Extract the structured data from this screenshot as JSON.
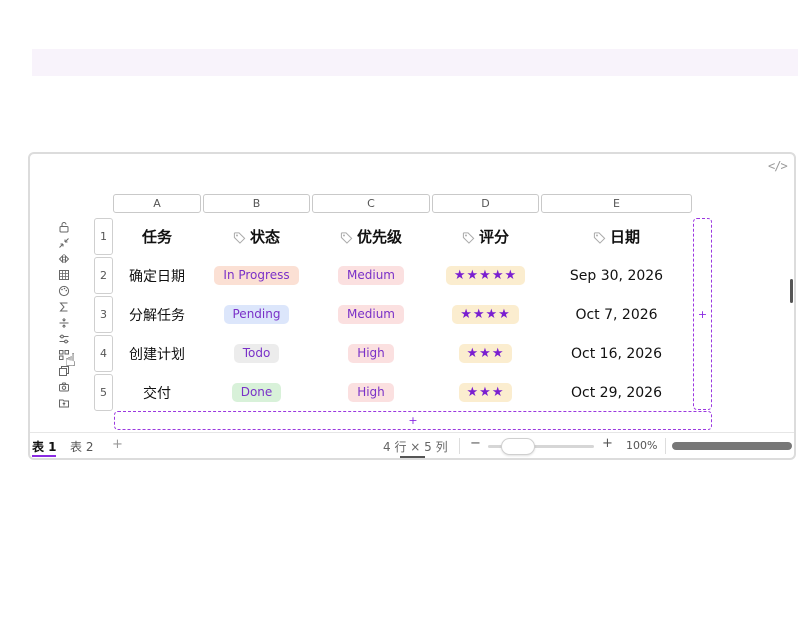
{
  "code_button": "</>",
  "columns": [
    "A",
    "B",
    "C",
    "D",
    "E"
  ],
  "row_numbers": [
    "1",
    "2",
    "3",
    "4",
    "5"
  ],
  "header_row": {
    "task": "任务",
    "status": "状态",
    "priority": "优先级",
    "rating": "评分",
    "date": "日期"
  },
  "rows": [
    {
      "task": "确定日期",
      "status": "In Progress",
      "priority": "Medium",
      "rating": "★★★★★",
      "date": "Sep 30, 2026"
    },
    {
      "task": "分解任务",
      "status": "Pending",
      "priority": "Medium",
      "rating": "★★★★",
      "date": "Oct 7, 2026"
    },
    {
      "task": "创建计划",
      "status": "Todo",
      "priority": "High",
      "rating": "★★★",
      "date": "Oct 16, 2026"
    },
    {
      "task": "交付",
      "status": "Done",
      "priority": "High",
      "rating": "★★★",
      "date": "Oct 29, 2026"
    }
  ],
  "add_column": "+",
  "add_row": "+",
  "sheets": [
    "表 1",
    "表 2"
  ],
  "add_sheet": "+",
  "dimensions": "4 行 × 5 列",
  "zoom": {
    "minus": "−",
    "plus": "+",
    "value": "100%"
  },
  "toolbar_icons": [
    "lock-icon",
    "collapse-icon",
    "flip-icon",
    "table-icon",
    "palette-icon",
    "sigma-icon",
    "split-icon",
    "sliders-icon",
    "grid-icon",
    "copy-icon",
    "camera-icon",
    "folder-upload-icon"
  ],
  "colors": {
    "accent": "#8a2be2",
    "in_progress_bg": "#fbe0d4",
    "pending_bg": "#dce6fb",
    "todo_bg": "#ececec",
    "done_bg": "#d8f1d9",
    "priority_bg": "#fbe0e0",
    "rating_bg": "#fbedcf"
  }
}
